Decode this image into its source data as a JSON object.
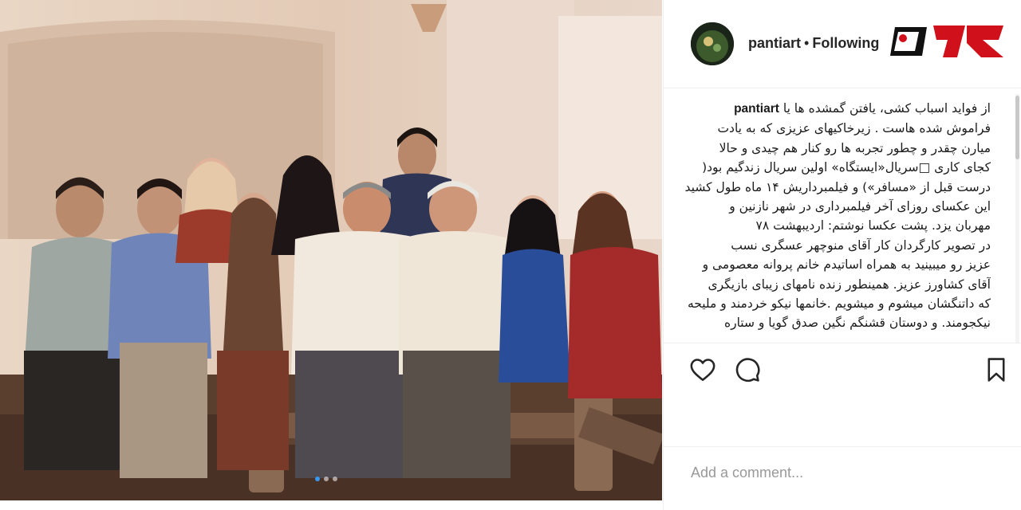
{
  "post": {
    "username": "pantiart",
    "separator": "•",
    "follow_status": "Following",
    "caption_lines": [
      "از فواید اسباب کشی، یافتن گمشده ها یا",
      "فراموش شده هاست . زیرخاکیهای عزیزی که به یادت",
      "میارن چقدر و چطور تجربه ها رو کنار هم چیدی و حالا",
      "کجای کاری □سریال«ایستگاه» اولین سریال زندگیم بود(",
      "درست قبل از «مسافر») و فیلمبرداریش ۱۴ ماه طول کشید",
      "این عکسای روزای آخر فیلمبرداری در شهر نازنین و",
      "مهربان یزد. پشت عکسا نوشتم: اردیبهشت ۷۸",
      "در تصویر کارگردان کار آقای منوچهر عسگری نسب",
      "عزیز رو میبینید به همراه اساتیدم خانم پروانه معصومی و",
      "آقای کشاورز عزیز. همینطور زنده نامهای زیبای بازیگری",
      "که داتنگشان میشوم و میشویم .خانمها نیکو خردمند و ملیحه",
      "نیکجومند. و دوستان قشنگم نگین صدق گویا و ستاره"
    ],
    "comment_placeholder": "Add a comment...",
    "carousel": {
      "count": 3,
      "active_index": 0
    }
  },
  "icons": {
    "like": "heart-icon",
    "comment": "speech-bubble-icon",
    "save": "bookmark-icon",
    "logo": "rokna-logo"
  },
  "colors": {
    "text": "#262626",
    "placeholder": "#999999",
    "border": "#efefef",
    "active_dot": "#3897f0",
    "logo_red": "#d0101a",
    "logo_black": "#111111"
  }
}
